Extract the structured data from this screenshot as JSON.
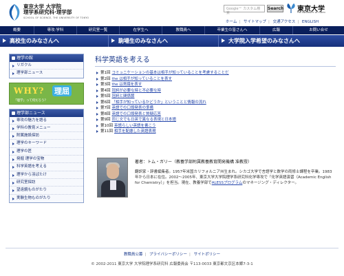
{
  "header": {
    "logo": {
      "line1": "東京大学 大学院",
      "line2": "理学系研究科·理学部",
      "line3": "SCHOOL OF SCIENCE, THE UNIVERSITY OF TOKYO"
    },
    "search": {
      "placeholder": "Google™ カスタム検索",
      "button_label": "Search"
    },
    "university": {
      "name": "東京大学",
      "sub": "THE UNIVERSITY OF TOKYO"
    },
    "util_links": [
      "ホーム",
      "サイトマップ",
      "交通アクセス",
      "ENGLISH"
    ]
  },
  "global_nav": [
    "概要",
    "専攻·学科",
    "研究室一覧",
    "在学生へ",
    "教職員へ",
    "卒業生の皆さんへ",
    "広報",
    "お問い合せ"
  ],
  "audience_bar": [
    "高校生のみなさんへ",
    "駒場生のみなさんへ",
    "大学院入学希望のみなさんへ"
  ],
  "sidebar": {
    "box1": {
      "title": "理学の館",
      "items": [
        "リガクル",
        "理学部ニュース"
      ]
    },
    "banner": {
      "word": "WHY?",
      "badge": "理屈",
      "caption": "「理学」って何だろう？"
    },
    "box2": {
      "title": "理学部ニュース",
      "items": [
        "専攻の魅力を語る",
        "学科の教育メニュー",
        "附属施設探訪",
        "理学のキーワード",
        "理学の匠",
        "発掘 理学の宝物",
        "科学英語を考える",
        "理学から羽ばたけ",
        "研究室探訪",
        "望遠鏡ものがたり",
        "実験生物ものがたり"
      ]
    }
  },
  "main": {
    "title": "科学英語を考える",
    "chapters": [
      {
        "num": "第1回",
        "title": "コミュニケーションの基本は相手が知っていることを考慮することだ"
      },
      {
        "num": "第2回",
        "title": "the は相手が知っていることを表す"
      },
      {
        "num": "第3回",
        "title": "the は常識を表す"
      },
      {
        "num": "第4回",
        "title": "冠詞が必要な時と不必要な時"
      },
      {
        "num": "第5回",
        "title": "冠詞と関係節"
      },
      {
        "num": "第6回",
        "title": "「相手が知っているかどうか」ということと情報の流れ"
      },
      {
        "num": "第7回",
        "title": "英語での口頭発表の準備"
      },
      {
        "num": "第8回",
        "title": "英語での口頭発表と質疑応答"
      },
      {
        "num": "第9回",
        "title": "同じ文でも日英で異なる表現と日本語"
      },
      {
        "num": "第10回",
        "title": "英語らしい英語を書こう"
      },
      {
        "num": "第11回",
        "title": "相手を配慮した英語表現"
      }
    ],
    "author": {
      "name": "著者：トム・ガリー（教養学部附属教養教育開発機構 准教授）",
      "bio": "翻訳家・辞書編集者。1957年米国カリフォルニア州生まれ。シカゴ大学で言語学と数学の両修士課程を卒業。1983年から日本に在住。2002～2005年、東京大学大学院理学系研究科化学専攻で「化学英語演習（Academic English for Chemistry）」を担当。現在、教養学部で",
      "link": "ALESSプログラム",
      "bio_end": "のマネージング・ディレクター。"
    }
  },
  "footer": {
    "links": [
      "教職員公募",
      "プライバシーポリシー",
      "サイトポリシー"
    ],
    "copyright": "© 2002-2011 東京大学 大学院理学系研究科 広報委員会 〒113-0033 東京都文京区本郷7-3-1"
  },
  "colors": {
    "nav_bg": "#0a1f5c",
    "audience_bar": "#1f3b85",
    "link": "#2244aa",
    "banner_bg": "#7ab648"
  },
  "icons": [
    "university-logo-icon",
    "arrow-right-icon",
    "bullet-triangle-icon"
  ]
}
